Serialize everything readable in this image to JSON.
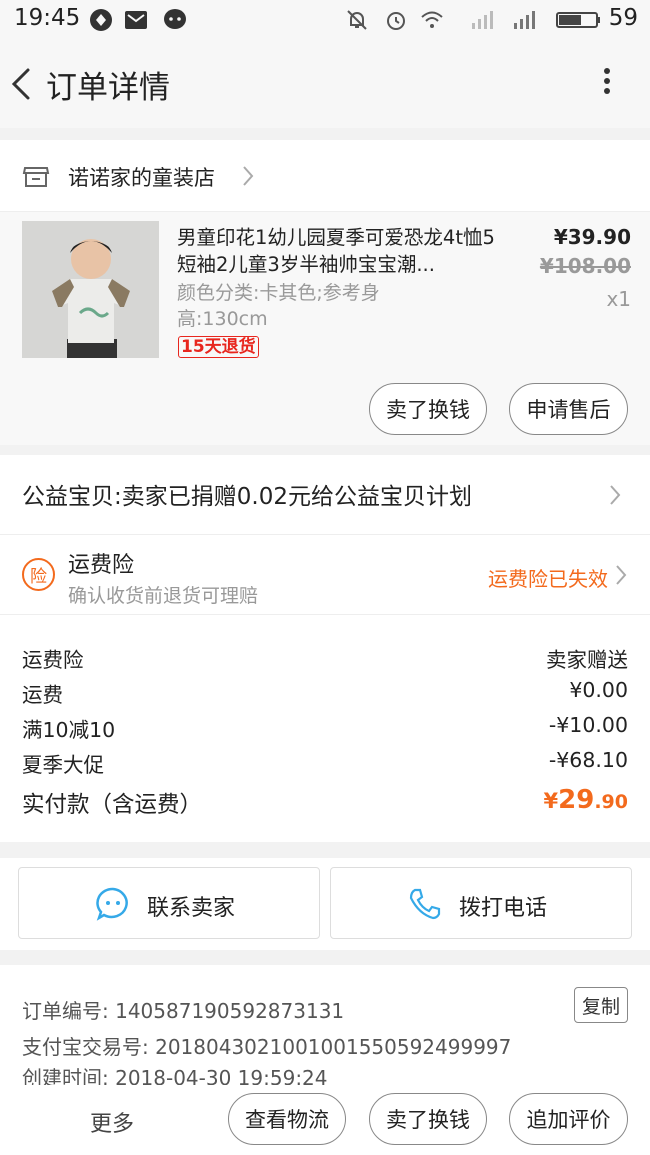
{
  "status_bar": {
    "time": "19:45",
    "battery": "59"
  },
  "nav": {
    "title": "订单详情"
  },
  "shop": {
    "name": "诺诺家的童装店"
  },
  "product": {
    "title": "男童印花1幼儿园夏季可爱恐龙4t恤5短袖2儿童3岁半袖帅宝宝潮...",
    "spec": "颜色分类:卡其色;参考身高:130cm",
    "badge": "15天退货",
    "price": "¥39.90",
    "original_price": "¥108.00",
    "quantity": "x1",
    "actions": {
      "sell": "卖了换钱",
      "after_sale": "申请售后"
    }
  },
  "charity": {
    "text": "公益宝贝:卖家已捐赠0.02元给公益宝贝计划"
  },
  "insurance": {
    "icon_char": "险",
    "title": "运费险",
    "subtitle": "确认收货前退货可理赔",
    "status": "运费险已失效"
  },
  "costs": {
    "rows": [
      {
        "label": "运费险",
        "value": "卖家赠送"
      },
      {
        "label": "运费",
        "value": "¥0.00"
      },
      {
        "label": "满10减10",
        "value": "-¥10.00"
      },
      {
        "label": "夏季大促",
        "value": "-¥68.10"
      }
    ],
    "total_label": "实付款（含运费）",
    "total_currency": "¥",
    "total_int": "29",
    "total_dec": ".90"
  },
  "contact": {
    "seller": "联系卖家",
    "call": "拨打电话"
  },
  "order_info": {
    "order_no": "订单编号: 140587190592873131",
    "copy": "复制",
    "alipay_no": "支付宝交易号: 2018043021001001550592499997",
    "created": "创建时间: 2018-04-30 19:59:24"
  },
  "bottom": {
    "more": "更多",
    "logistics": "查看物流",
    "sell": "卖了换钱",
    "review": "追加评价"
  },
  "colors": {
    "accent": "#f36a1d",
    "badge": "#e8261e",
    "chat_icon": "#35a9e8"
  }
}
